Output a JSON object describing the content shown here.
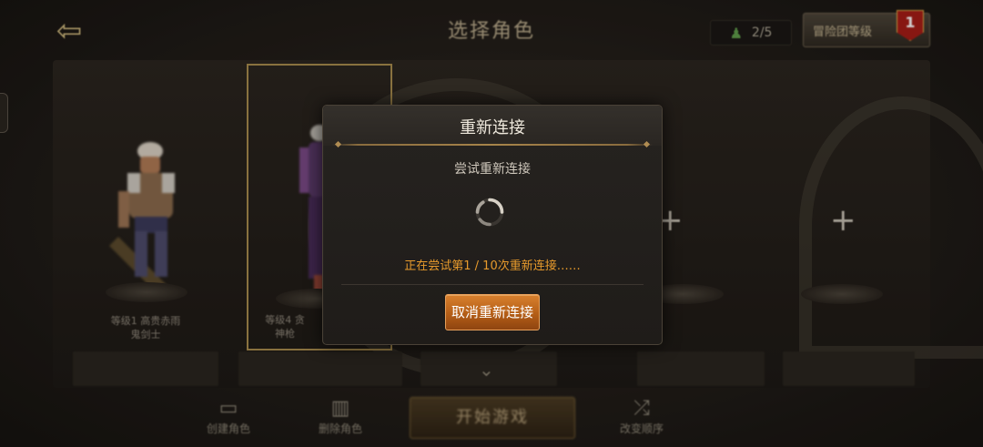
{
  "header": {
    "title": "选择角色",
    "slots": "2/5",
    "rank_button_label": "冒险团等级",
    "rank_badge": "1"
  },
  "characters": [
    {
      "line1": "等级1 高贵赤雨",
      "line2": "鬼剑士"
    },
    {
      "line1": "等级4 贪",
      "line2": "神枪"
    }
  ],
  "dialog": {
    "title": "重新连接",
    "message": "尝试重新连接",
    "status": "正在尝试第1 / 10次重新连接……",
    "cancel_label": "取消重新连接"
  },
  "bottom_bar": {
    "create_label": "创建角色",
    "delete_label": "删除角色",
    "start_label": "开始游戏",
    "reorder_label": "改变顺序"
  },
  "colors": {
    "accent_orange": "#e79a2c",
    "button_orange": "#c46a1f",
    "gold_frame": "#a88b4e"
  }
}
